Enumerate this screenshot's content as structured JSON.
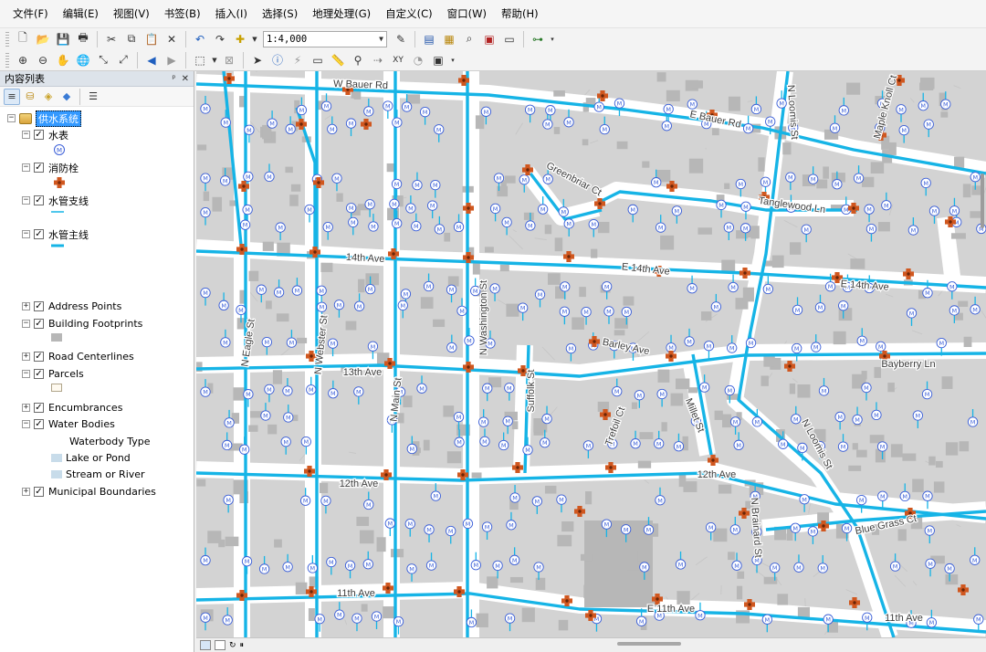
{
  "menu": [
    "文件(F)",
    "编辑(E)",
    "视图(V)",
    "书签(B)",
    "插入(I)",
    "选择(S)",
    "地理处理(G)",
    "自定义(C)",
    "窗口(W)",
    "帮助(H)"
  ],
  "toolbar": {
    "scale_value": "1:4,000"
  },
  "toc": {
    "title": "内容列表",
    "pin": "ᵖ",
    "close": "✕",
    "group": "供水系统",
    "layers": [
      {
        "name": "水表",
        "symbol": "meter",
        "symbol_label": "M"
      },
      {
        "name": "消防栓",
        "symbol": "hydrant"
      },
      {
        "name": "水管支线",
        "symbol": "thin-line"
      },
      {
        "name": "水管主线",
        "symbol": "thick-line"
      }
    ],
    "other_layers": [
      {
        "name": "Address Points"
      },
      {
        "name": "Building Footprints",
        "symbol": "gray-box"
      },
      {
        "name": "Road Centerlines"
      },
      {
        "name": "Parcels",
        "symbol": "parcel-box"
      },
      {
        "name": "Encumbrances"
      },
      {
        "name": "Water Bodies",
        "subheading": "Waterbody Type",
        "classes": [
          "Lake or Pond",
          "Stream or River"
        ]
      },
      {
        "name": "Municipal Boundaries"
      }
    ]
  },
  "map": {
    "streets": [
      "W Bauer Rd",
      "E Bauer Rd",
      "N Loomis St",
      "Maple Knoll Ct",
      "Greenbriar Ct",
      "Tanglewood Ln",
      "14th Ave",
      "E 14th Ave",
      "E 14th Ave",
      "N Washington St",
      "N Eagle St",
      "N Webster St",
      "N Main St",
      "13th Ave",
      "Barley Ave",
      "Suffolk St",
      "Trefoil Ct",
      "Millet St",
      "Bayberry Ln",
      "12th Ave",
      "12th Ave",
      "N Loomis St",
      "Blue Grass Ct",
      "N Brainard St",
      "11th Ave",
      "E 11th Ave",
      "11th Ave"
    ],
    "colors": {
      "water_line": "#16b4e6",
      "meter_stroke": "#3b5fd8",
      "hydrant": "#d0571f",
      "parcel": "#d3d3d3",
      "building": "#b7b7b7",
      "road": "#ffffff"
    }
  }
}
